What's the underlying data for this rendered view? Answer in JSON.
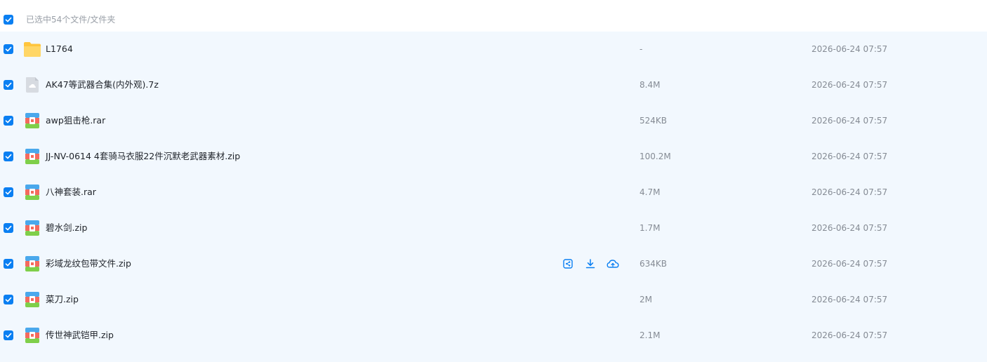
{
  "header": {
    "selection_label": "已选中54个文件/文件夹"
  },
  "colors": {
    "accent": "#0a7ff2",
    "row_background": "#f2f8fe",
    "folder": "#ffc53d",
    "archive_blue": "#4aa8ec",
    "archive_red": "#f46a5e",
    "archive_green": "#7fcf4a"
  },
  "files": [
    {
      "name": "L1764",
      "size": "-",
      "date": "2026-06-24 07:57",
      "icon": "folder-icon",
      "selected": true
    },
    {
      "name": "AK47等武器合集(内外观).7z",
      "size": "8.4M",
      "date": "2026-06-24 07:57",
      "icon": "generic-file-icon",
      "selected": true
    },
    {
      "name": "awp狙击枪.rar",
      "size": "524KB",
      "date": "2026-06-24 07:57",
      "icon": "archive-icon",
      "selected": true
    },
    {
      "name": "JJ-NV-0614 4套骑马衣服22件沉默老武器素材.zip",
      "size": "100.2M",
      "date": "2026-06-24 07:57",
      "icon": "archive-icon",
      "selected": true
    },
    {
      "name": "八神套装.rar",
      "size": "4.7M",
      "date": "2026-06-24 07:57",
      "icon": "archive-icon",
      "selected": true
    },
    {
      "name": "碧水剑.zip",
      "size": "1.7M",
      "date": "2026-06-24 07:57",
      "icon": "archive-icon",
      "selected": true
    },
    {
      "name": "彩域龙纹包带文件.zip",
      "size": "634KB",
      "date": "2026-06-24 07:57",
      "icon": "archive-icon",
      "selected": true,
      "hovered": true
    },
    {
      "name": "菜刀.zip",
      "size": "2M",
      "date": "2026-06-24 07:57",
      "icon": "archive-icon",
      "selected": true
    },
    {
      "name": "传世神武铠甲.zip",
      "size": "2.1M",
      "date": "2026-06-24 07:57",
      "icon": "archive-icon",
      "selected": true
    }
  ],
  "row_actions": [
    {
      "icon": "share-icon"
    },
    {
      "icon": "download-icon"
    },
    {
      "icon": "cloud-save-icon"
    }
  ]
}
